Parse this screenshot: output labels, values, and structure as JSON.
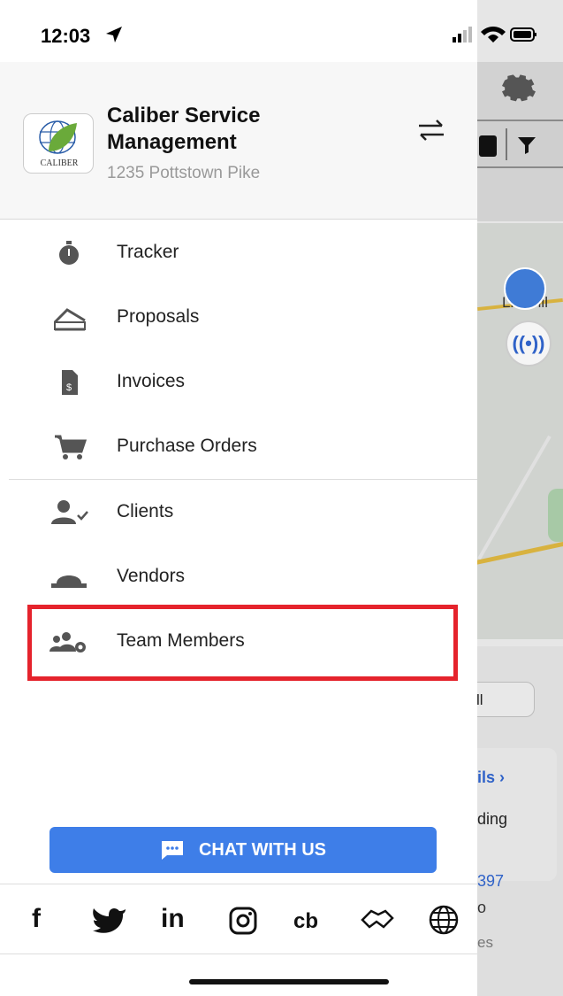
{
  "status_bar": {
    "time": "12:03"
  },
  "account": {
    "company_name": "Caliber Service Management",
    "address": "1235 Pottstown Pike",
    "logo_text": "CALIBER"
  },
  "menu": {
    "group1": [
      {
        "label": "Tracker",
        "icon": "stopwatch-icon"
      },
      {
        "label": "Proposals",
        "icon": "proposal-sign-icon"
      },
      {
        "label": "Invoices",
        "icon": "invoice-dollar-icon"
      },
      {
        "label": "Purchase Orders",
        "icon": "cart-icon"
      }
    ],
    "group2": [
      {
        "label": "Clients",
        "icon": "user-check-icon"
      },
      {
        "label": "Vendors",
        "icon": "hard-hat-icon"
      },
      {
        "label": "Team Members",
        "icon": "users-gear-icon"
      }
    ]
  },
  "chat_button": {
    "label": "CHAT WITH US"
  },
  "social": [
    {
      "text": "f",
      "icon": "facebook-icon"
    },
    {
      "text": "",
      "icon": "twitter-icon"
    },
    {
      "text": "in",
      "icon": "linkedin-icon"
    },
    {
      "text": "",
      "icon": "instagram-icon"
    },
    {
      "text": "cb",
      "icon": "crunchbase-icon"
    },
    {
      "text": "",
      "icon": "handshake-icon"
    },
    {
      "text": "",
      "icon": "globe-icon"
    }
  ],
  "background": {
    "town_label": "Lionvill",
    "pill_label": "ll",
    "details_link": "ils ›",
    "pending": "ding",
    "number": "397",
    "o": "o",
    "es": "es"
  },
  "colors": {
    "accent": "#3e7ee8",
    "highlight": "#e5232c"
  }
}
